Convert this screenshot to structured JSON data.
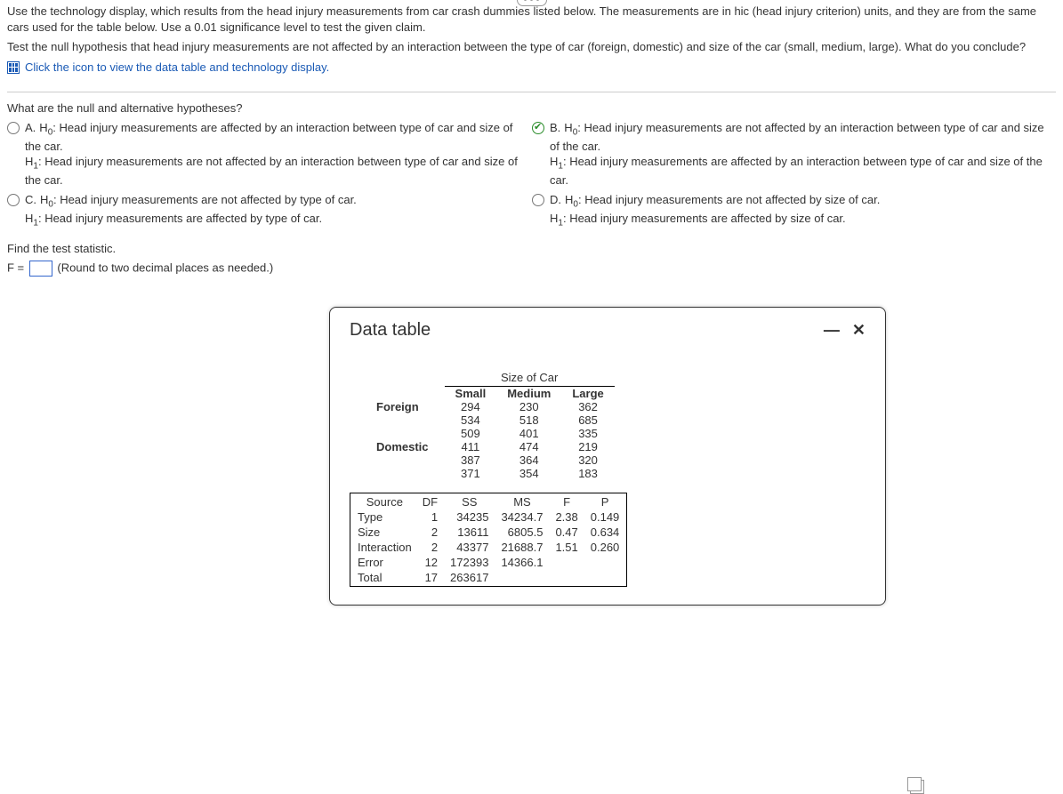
{
  "intro": {
    "p1": "Use the technology display, which results from the head injury measurements from car crash dummies listed below. The measurements are in hic (head injury criterion) units, and they are from the same cars used for the table below. Use a 0.01 significance level to test the given claim.",
    "p2": "Test the null hypothesis that head injury measurements are not affected by an interaction between the type of car (foreign, domestic) and size of the car (small, medium, large). What do you conclude?",
    "link": "Click the icon to view the data table and technology display."
  },
  "q1": "What are the null and alternative hypotheses?",
  "options": {
    "A": {
      "h0": "Head injury measurements are affected by an interaction between type of car and size of the car.",
      "h1": "Head injury measurements are not affected by an interaction between type of car and size of the car."
    },
    "B": {
      "h0": "Head injury measurements are not affected by an interaction between type of car and size of the car.",
      "h1": "Head injury measurements are affected by an interaction between type of car and size of the car."
    },
    "C": {
      "h0": "Head injury measurements are not affected by type of car.",
      "h1": "Head injury measurements are affected by type of car."
    },
    "D": {
      "h0": "Head injury measurements are not affected by size of car.",
      "h1": "Head injury measurements are affected by size of car."
    }
  },
  "selected": "B",
  "find": {
    "label": "Find the test statistic.",
    "prefix": "F =",
    "hint": "(Round to two decimal places as needed.)"
  },
  "modal": {
    "title": "Data table",
    "sizeHeader": "Size of Car",
    "cols": [
      "Small",
      "Medium",
      "Large"
    ],
    "rows": [
      {
        "label": "Foreign",
        "vals": [
          [
            "294",
            "230",
            "362"
          ],
          [
            "534",
            "518",
            "685"
          ],
          [
            "509",
            "401",
            "335"
          ]
        ]
      },
      {
        "label": "Domestic",
        "vals": [
          [
            "411",
            "474",
            "219"
          ],
          [
            "387",
            "364",
            "320"
          ],
          [
            "371",
            "354",
            "183"
          ]
        ]
      }
    ],
    "anova_head": [
      "Source",
      "DF",
      "SS",
      "MS",
      "F",
      "P"
    ],
    "anova": [
      [
        "Type",
        "1",
        "34235",
        "34234.7",
        "2.38",
        "0.149"
      ],
      [
        "Size",
        "2",
        "13611",
        "6805.5",
        "0.47",
        "0.634"
      ],
      [
        "Interaction",
        "2",
        "43377",
        "21688.7",
        "1.51",
        "0.260"
      ],
      [
        "Error",
        "12",
        "172393",
        "14366.1",
        "",
        ""
      ],
      [
        "Total",
        "17",
        "263617",
        "",
        "",
        ""
      ]
    ]
  },
  "chart_data": {
    "type": "table",
    "title": "Two-way ANOVA: head injury (hic) by car type × size",
    "factors": {
      "Type": [
        "Foreign",
        "Domestic"
      ],
      "Size": [
        "Small",
        "Medium",
        "Large"
      ]
    },
    "observations": {
      "Foreign": {
        "Small": [
          294,
          534,
          509
        ],
        "Medium": [
          230,
          518,
          401
        ],
        "Large": [
          362,
          685,
          335
        ]
      },
      "Domestic": {
        "Small": [
          411,
          387,
          371
        ],
        "Medium": [
          474,
          364,
          354
        ],
        "Large": [
          219,
          320,
          183
        ]
      }
    },
    "anova": [
      {
        "source": "Type",
        "df": 1,
        "ss": 34235,
        "ms": 34234.7,
        "f": 2.38,
        "p": 0.149
      },
      {
        "source": "Size",
        "df": 2,
        "ss": 13611,
        "ms": 6805.5,
        "f": 0.47,
        "p": 0.634
      },
      {
        "source": "Interaction",
        "df": 2,
        "ss": 43377,
        "ms": 21688.7,
        "f": 1.51,
        "p": 0.26
      },
      {
        "source": "Error",
        "df": 12,
        "ss": 172393,
        "ms": 14366.1
      },
      {
        "source": "Total",
        "df": 17,
        "ss": 263617
      }
    ]
  }
}
